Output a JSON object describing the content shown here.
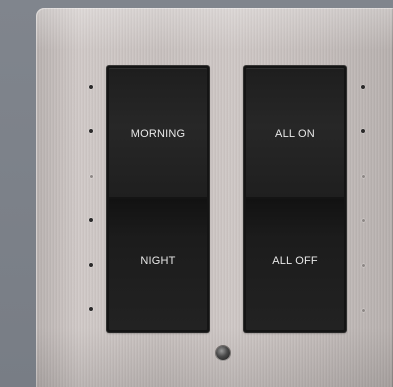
{
  "panel": {
    "buttons": [
      {
        "label": "MORNING"
      },
      {
        "label": "NIGHT"
      },
      {
        "label": "ALL ON"
      },
      {
        "label": "ALL OFF"
      }
    ]
  },
  "colors": {
    "wall": "#7b8088",
    "faceplate": "#c8c1bf",
    "rocker": "#222222",
    "label": "#e8e8e8"
  }
}
